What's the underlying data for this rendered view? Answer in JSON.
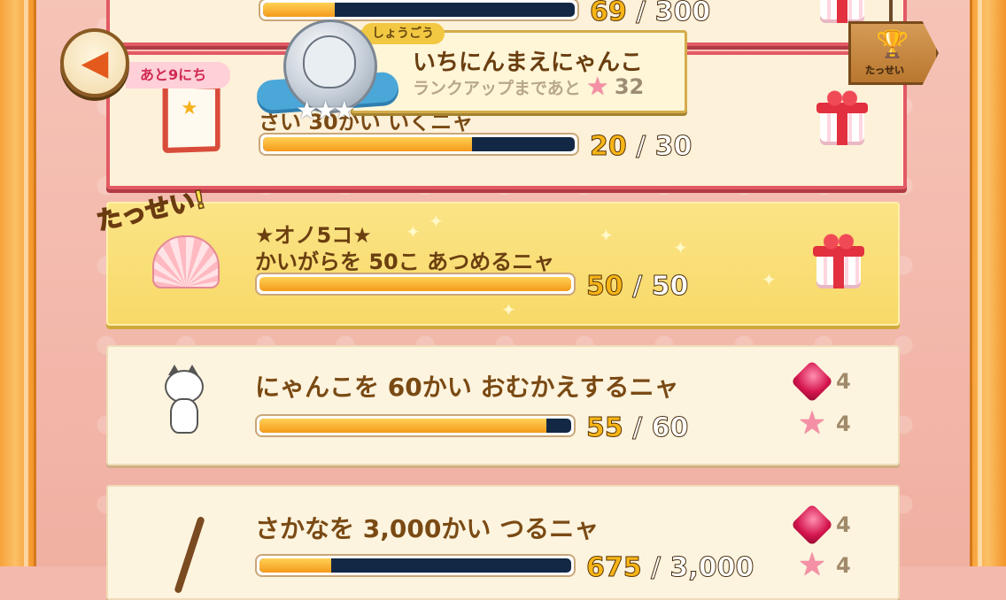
{
  "header": {
    "back_label": "",
    "days_left": "あと9にち",
    "tassei_label": "たっせい"
  },
  "rank": {
    "tag": "しょうごう",
    "name": "いちにんまえにゃんこ",
    "next_text": "ランクアップまであと",
    "next_value": "32"
  },
  "missions": [
    {
      "title": "",
      "count": "69",
      "total": "300",
      "progress": 0.23,
      "state": "claimable"
    },
    {
      "star_line": "",
      "title": "さい 30かい いくニャ",
      "count": "20",
      "total": "30",
      "progress": 0.67,
      "state": "claimable"
    },
    {
      "star_line": "★オノ5コ★",
      "title": "かいがらを 50こ あつめるニャ",
      "count": "50",
      "total": "50",
      "progress": 1.0,
      "state": "achieved",
      "stamp": "たっせい!"
    },
    {
      "title": "にゃんこを 60かい おむかえするニャ",
      "count": "55",
      "total": "60",
      "progress": 0.92,
      "rewards": [
        {
          "icon": "gem-icon",
          "amount": "4"
        },
        {
          "icon": "star-icon",
          "amount": "4"
        }
      ]
    },
    {
      "title": "さかなを 3,000かい つるニャ",
      "count": "675",
      "total": "3,000",
      "progress": 0.23,
      "rewards": [
        {
          "icon": "gem-icon",
          "amount": "4"
        },
        {
          "icon": "star-icon",
          "amount": "4"
        }
      ]
    }
  ],
  "separator": "/",
  "colors": {
    "accent_red": "#e25a64",
    "achieved_gold": "#f8d968",
    "bar_fill": "#f59a1b",
    "bar_track": "#132844"
  }
}
